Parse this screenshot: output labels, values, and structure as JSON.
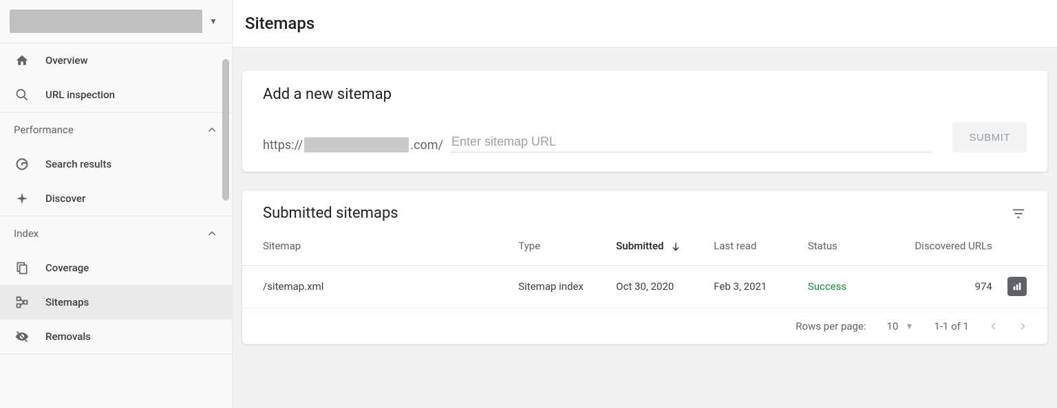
{
  "sidebar": {
    "items": [
      {
        "label": "Overview"
      },
      {
        "label": "URL inspection"
      }
    ],
    "performance": {
      "header": "Performance",
      "items": [
        {
          "label": "Search results"
        },
        {
          "label": "Discover"
        }
      ]
    },
    "index": {
      "header": "Index",
      "items": [
        {
          "label": "Coverage"
        },
        {
          "label": "Sitemaps"
        },
        {
          "label": "Removals"
        }
      ]
    }
  },
  "header": {
    "title": "Sitemaps"
  },
  "add_card": {
    "title": "Add a new sitemap",
    "prefix_left": "https://",
    "prefix_right": ".com/",
    "placeholder": "Enter sitemap URL",
    "submit": "SUBMIT"
  },
  "submitted": {
    "title": "Submitted sitemaps",
    "columns": {
      "sitemap": "Sitemap",
      "type": "Type",
      "submitted": "Submitted",
      "last_read": "Last read",
      "status": "Status",
      "discovered": "Discovered URLs"
    },
    "rows": [
      {
        "sitemap": "/sitemap.xml",
        "type": "Sitemap index",
        "submitted": "Oct 30, 2020",
        "last_read": "Feb 3, 2021",
        "status": "Success",
        "discovered": "974"
      }
    ],
    "pager": {
      "rows_label": "Rows per page:",
      "rows_value": "10",
      "range": "1-1 of 1"
    }
  }
}
